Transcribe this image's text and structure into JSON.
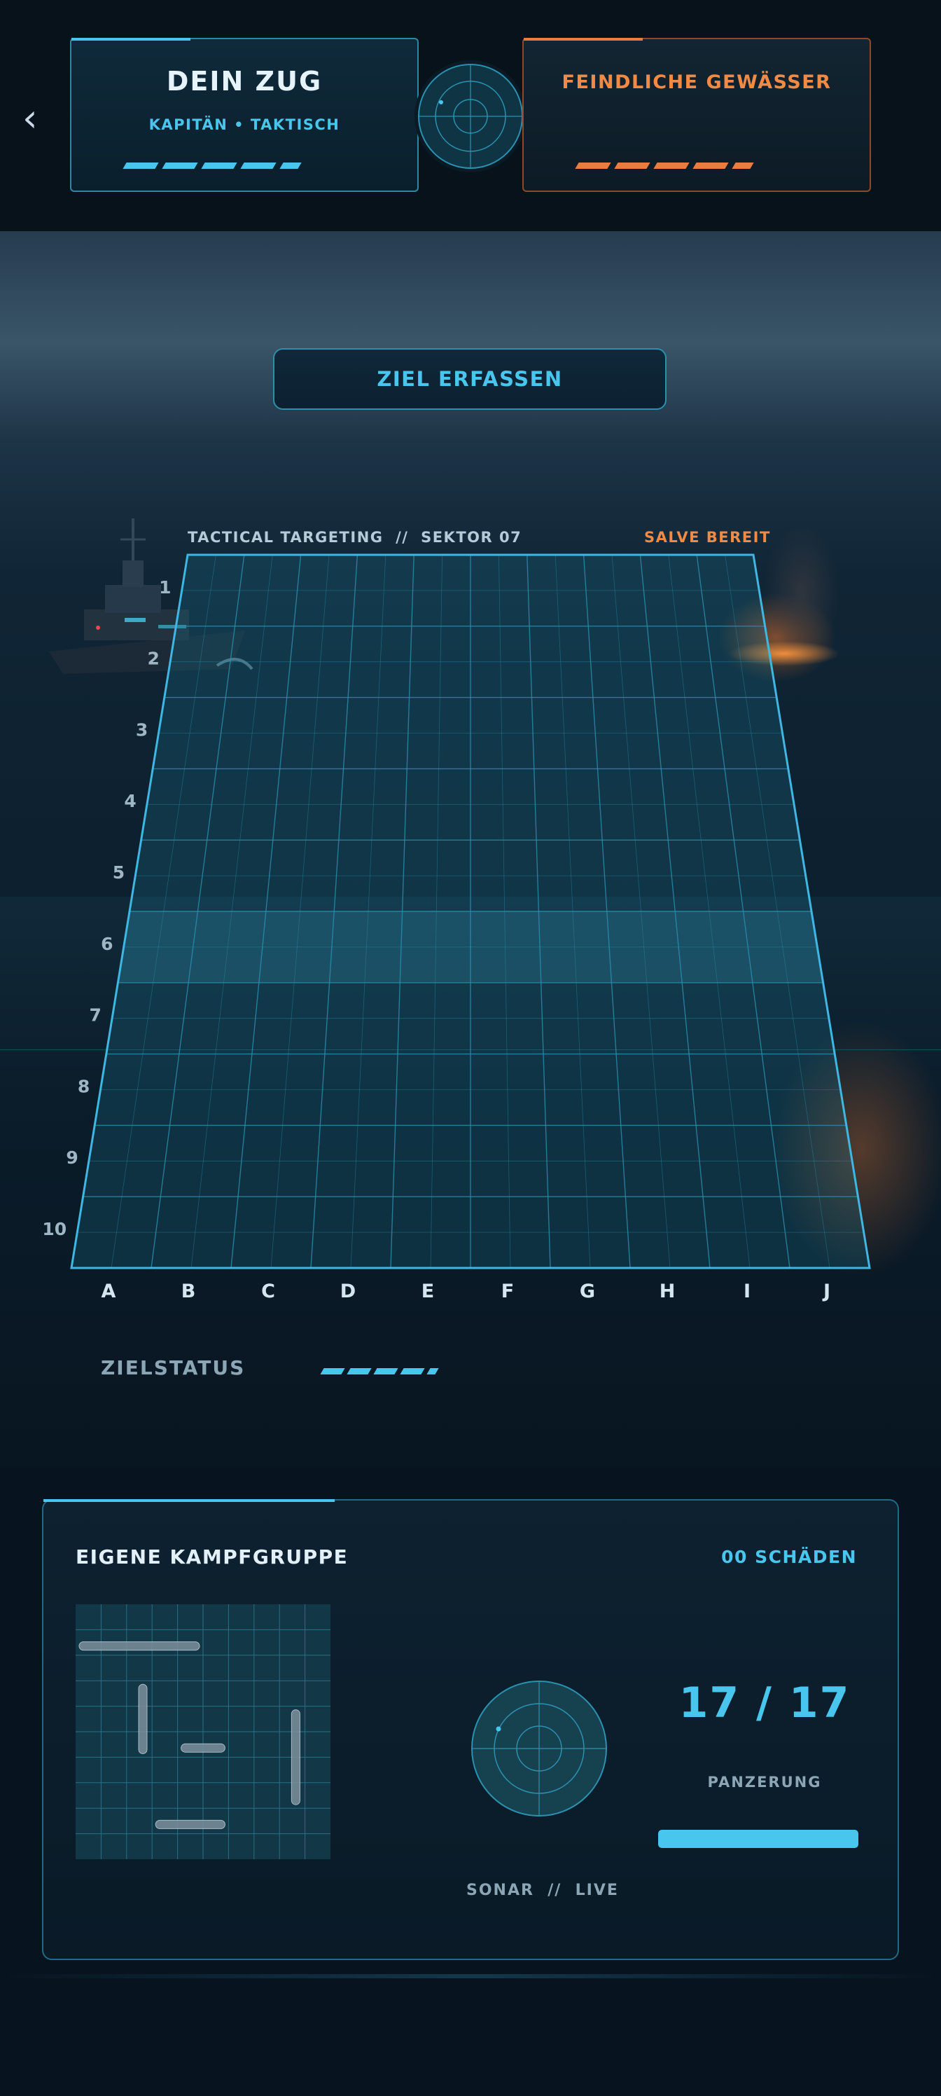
{
  "header": {
    "left_panel": {
      "title": "DEIN ZUG",
      "subtitle": "KAPITÄN • TAKTISCH"
    },
    "right_panel": {
      "title": "FEINDLICHE GEWÄSSER"
    }
  },
  "action": {
    "lock_target_label": "ZIEL ERFASSEN"
  },
  "targeting": {
    "header_left": "TACTICAL TARGETING  //  SEKTOR 07",
    "header_right": "SALVE BEREIT",
    "row_labels": [
      "1",
      "2",
      "3",
      "4",
      "5",
      "6",
      "7",
      "8",
      "9",
      "10"
    ],
    "col_labels": [
      "A",
      "B",
      "C",
      "D",
      "E",
      "F",
      "G",
      "H",
      "I",
      "J"
    ],
    "highlighted_row": 6
  },
  "target_status": {
    "label": "ZIELSTATUS"
  },
  "fleet": {
    "title": "EIGENE KAMPFGRUPPE",
    "damage": "00 SCHÄDEN",
    "sonar_label": "SONAR  //  LIVE",
    "armor_value": "17 / 17",
    "armor_label": "PANZERUNG",
    "armor_fraction": 1.0
  },
  "colors": {
    "accent": "#49c6ee",
    "enemy": "#f08a44",
    "background": "#07141f"
  },
  "icons": {
    "back": "chevron-left-icon",
    "radar": "radar-icon",
    "sonar": "sonar-icon"
  }
}
